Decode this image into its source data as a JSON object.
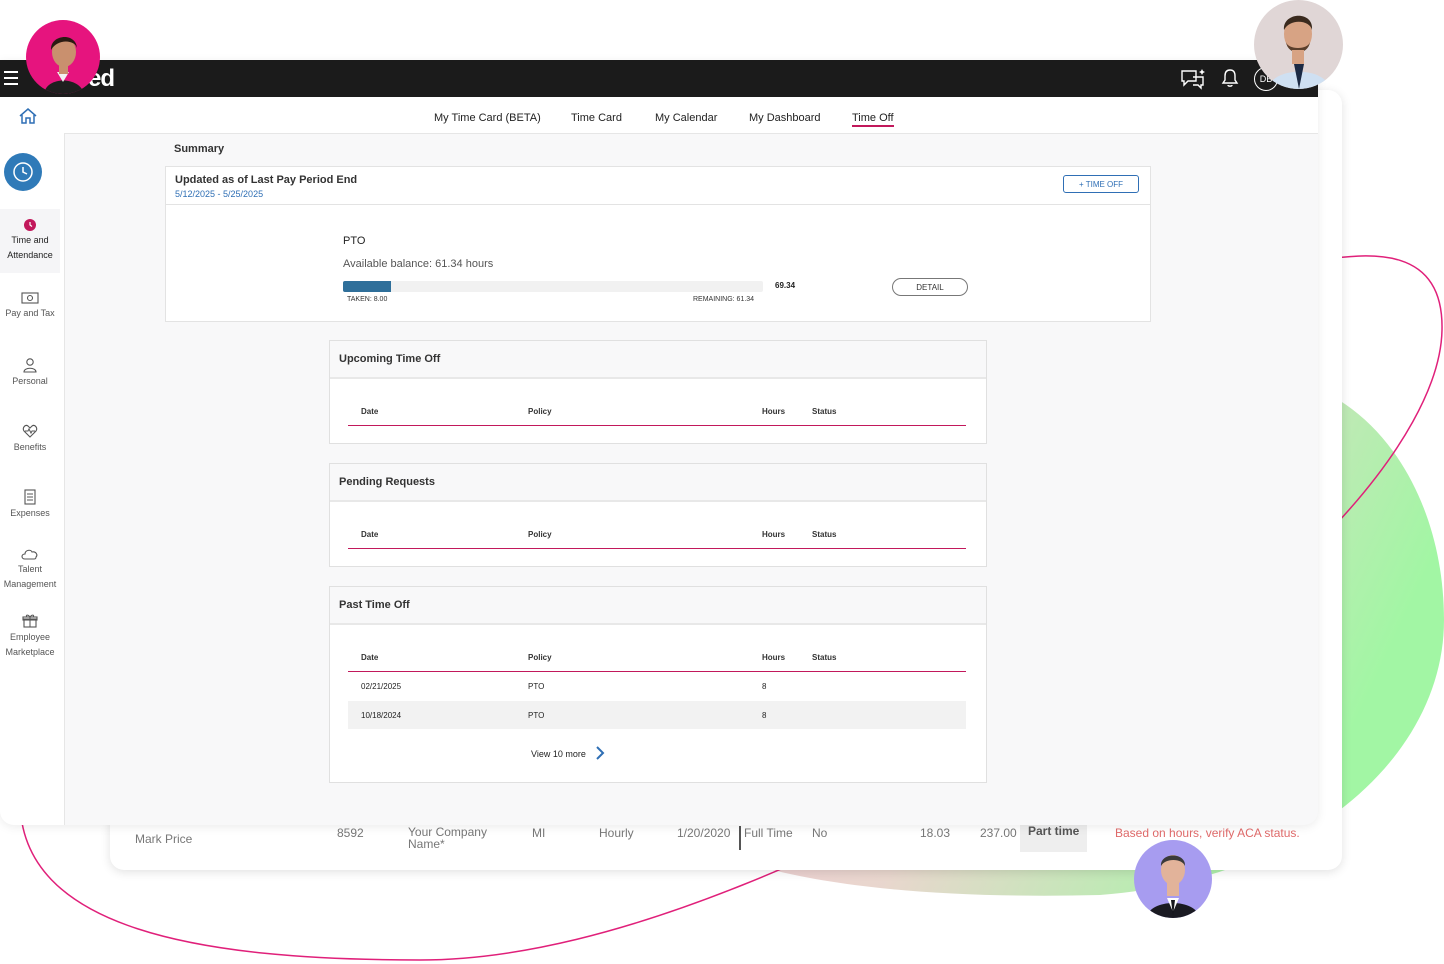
{
  "app": {
    "logo_text": "ed",
    "user_initials": "DB"
  },
  "subnav": {
    "tabs": [
      {
        "label": "My Time Card (BETA)"
      },
      {
        "label": "Time Card"
      },
      {
        "label": "My Calendar"
      },
      {
        "label": "My Dashboard"
      },
      {
        "label": "Time Off",
        "active": true
      }
    ]
  },
  "sidebar": {
    "items": [
      {
        "label": "Time and Attendance",
        "icon": "clock-icon",
        "active": true
      },
      {
        "label": "Pay and Tax",
        "icon": "money-icon"
      },
      {
        "label": "Personal",
        "icon": "person-icon"
      },
      {
        "label": "Benefits",
        "icon": "heart-icon"
      },
      {
        "label": "Expenses",
        "icon": "receipt-icon"
      },
      {
        "label": "Talent Management",
        "icon": "cloud-icon"
      },
      {
        "label": "Employee Marketplace",
        "icon": "gift-icon"
      }
    ]
  },
  "summary": {
    "label": "Summary",
    "title": "Updated as of Last Pay Period End",
    "date_range": "5/12/2025 - 5/25/2025",
    "time_off_button": "+ TIME OFF",
    "policy": "PTO",
    "available_balance": "Available balance: 61.34 hours",
    "total": "69.34",
    "taken_label": "TAKEN: 8.00",
    "remaining_label": "REMAINING: 61.34",
    "taken_fraction": 0.1154,
    "detail_button": "DETAIL"
  },
  "table_headers": {
    "date": "Date",
    "policy": "Policy",
    "hours": "Hours",
    "status": "Status"
  },
  "upcoming": {
    "title": "Upcoming Time Off"
  },
  "pending": {
    "title": "Pending Requests"
  },
  "past": {
    "title": "Past Time Off",
    "rows": [
      {
        "date": "02/21/2025",
        "policy": "PTO",
        "hours": "8",
        "status": ""
      },
      {
        "date": "10/18/2024",
        "policy": "PTO",
        "hours": "8",
        "status": ""
      }
    ],
    "view_more": "View 10 more"
  },
  "background_row": {
    "name": "Mark Price",
    "id": "8592",
    "company": "Your Company Name*",
    "state": "MI",
    "pay_type": "Hourly",
    "date": "1/20/2020",
    "employment": "Full Time",
    "flag": "No",
    "value1": "18.03",
    "value2": "237.00",
    "status": "Part time",
    "note": "Based on hours, verify ACA status."
  },
  "colors": {
    "accent": "#c2185b",
    "primary": "#2f6fb5",
    "bar_fill": "#2f6f9a",
    "topbar": "#1b1b1b",
    "green_blob": "#98f59a",
    "pink_blob": "#f7c2dd"
  }
}
